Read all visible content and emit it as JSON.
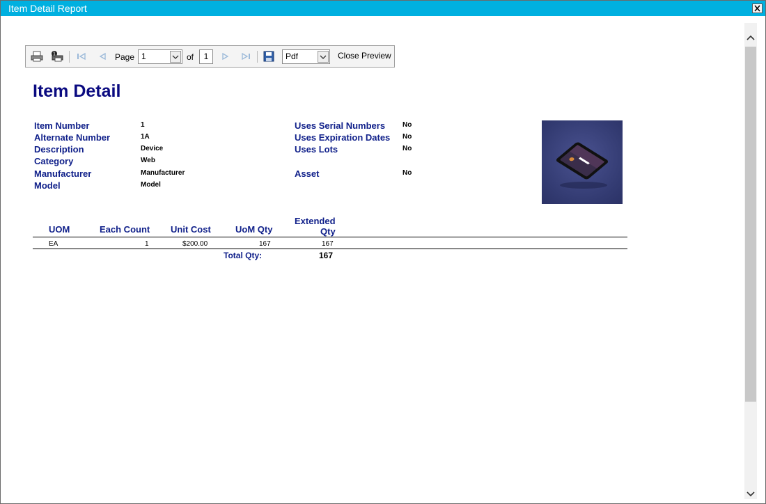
{
  "window": {
    "title": "Item Detail Report"
  },
  "toolbar": {
    "page_label": "Page",
    "page_value": "1",
    "of_label": "of",
    "total_pages": "1",
    "format_value": "Pdf",
    "close_preview_label": "Close Preview"
  },
  "report": {
    "title": "Item Detail",
    "left_fields": [
      {
        "label": "Item Number",
        "value": "1"
      },
      {
        "label": "Alternate Number",
        "value": "1A"
      },
      {
        "label": "Description",
        "value": "Device"
      },
      {
        "label": "Category",
        "value": "Web"
      },
      {
        "label": "Manufacturer",
        "value": "Manufacturer"
      },
      {
        "label": "Model",
        "value": "Model"
      }
    ],
    "right_fields": [
      {
        "label": "Uses Serial Numbers",
        "value": "No"
      },
      {
        "label": "Uses Expiration Dates",
        "value": "No"
      },
      {
        "label": "Uses Lots",
        "value": "No"
      },
      {
        "label": "Asset",
        "value": "No"
      }
    ],
    "table": {
      "headers": {
        "uom": "UOM",
        "each_count": "Each Count",
        "unit_cost": "Unit Cost",
        "uom_qty": "UoM Qty",
        "extended_line1": "Extended",
        "extended_line2": "Qty"
      },
      "rows": [
        {
          "uom": "EA",
          "each_count": "1",
          "unit_cost": "$200.00",
          "uom_qty": "167",
          "extended_qty": "167"
        }
      ],
      "total_label": "Total Qty:",
      "total_value": "167"
    }
  }
}
